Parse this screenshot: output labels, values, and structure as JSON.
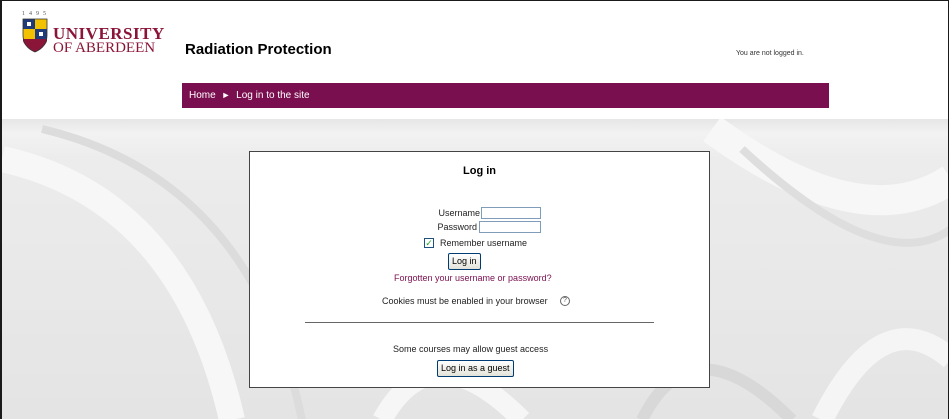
{
  "logo": {
    "year": "1495",
    "name_line1": "UNIVERSITY",
    "name_line2": "OF ABERDEEN",
    "crest_icon": "university-crest-icon"
  },
  "header": {
    "site_title": "Radiation Protection",
    "login_info": "You are not logged in."
  },
  "breadcrumb": {
    "home": "Home",
    "separator": "►",
    "current": "Log in to the site"
  },
  "login": {
    "title": "Log in",
    "username_label": "Username",
    "username_value": "",
    "password_label": "Password",
    "password_value": "",
    "remember_label": "Remember username",
    "remember_checked": true,
    "login_button": "Log in",
    "forgot_link": "Forgotten your username or password?",
    "cookies_text": "Cookies must be enabled in your browser",
    "help_icon": "help-icon",
    "guest_text": "Some courses may allow guest access",
    "guest_button": "Log in as a guest"
  },
  "colors": {
    "brand": "#7a0f4f",
    "logo_text": "#8b1538"
  }
}
